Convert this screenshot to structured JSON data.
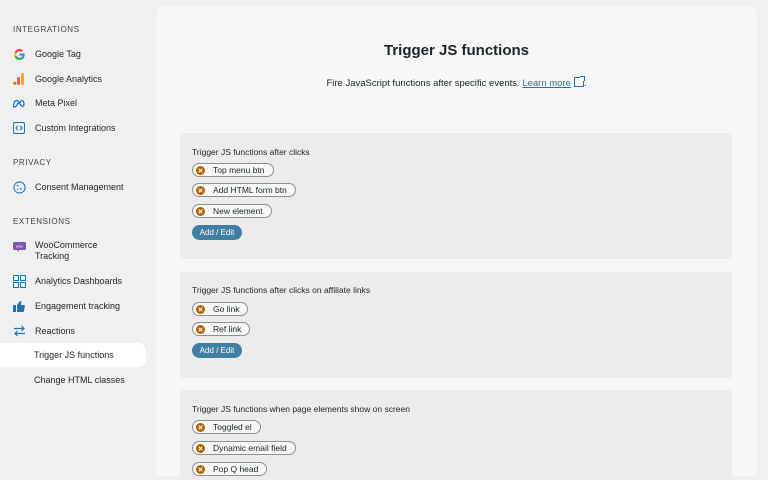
{
  "sidebar": {
    "sections": [
      {
        "title": "INTEGRATIONS"
      },
      {
        "title": "PRIVACY"
      },
      {
        "title": "EXTENSIONS"
      }
    ],
    "items": [
      {
        "label": "Google Tag",
        "icon": "google-icon"
      },
      {
        "label": "Google Analytics",
        "icon": "analytics-icon"
      },
      {
        "label": "Meta Pixel",
        "icon": "meta-icon"
      },
      {
        "label": "Custom Integrations",
        "icon": "code-icon"
      },
      {
        "label": "Consent Management",
        "icon": "cookie-icon"
      },
      {
        "label": "WooCommerce Tracking",
        "icon": "woo-icon"
      },
      {
        "label": "Analytics Dashboards",
        "icon": "dashboard-icon"
      },
      {
        "label": "Engagement tracking",
        "icon": "thumbs-up-icon"
      },
      {
        "label": "Reactions",
        "icon": "arrows-icon"
      },
      {
        "label": "Trigger JS functions",
        "icon": ""
      },
      {
        "label": "Change HTML classes",
        "icon": ""
      }
    ]
  },
  "main": {
    "title": "Trigger JS functions",
    "subtitle": "Fire JavaScript functions after specific events.",
    "learn_more": "Learn more",
    "period": "."
  },
  "cards": [
    {
      "title": "Trigger JS functions after clicks",
      "chips": [
        "Top menu btn",
        "Add HTML form btn",
        "New element"
      ],
      "button": "Add / Edit"
    },
    {
      "title": "Trigger JS functions after clicks on affiliate links",
      "chips": [
        "Go link",
        "Ref link"
      ],
      "button": "Add / Edit"
    },
    {
      "title": "Trigger JS functions when page elements show on screen",
      "chips": [
        "Toggled el",
        "Dynamic email field",
        "Pop Q head"
      ]
    }
  ],
  "colors": {
    "accent": "#3e7fa3",
    "chip_remove": "#b26200",
    "link": "#2271b1"
  }
}
